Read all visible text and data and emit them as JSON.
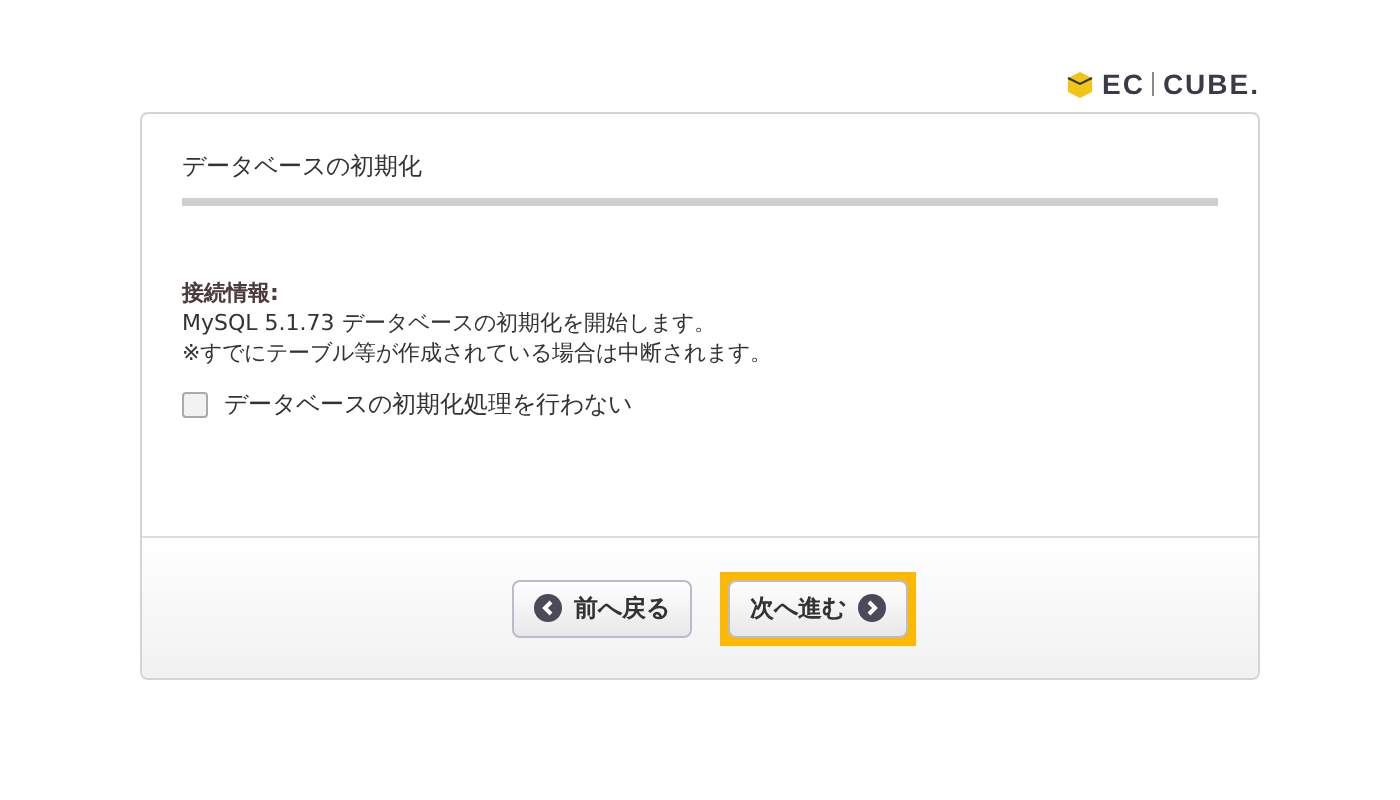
{
  "logo": {
    "left": "EC",
    "right": "CUBE."
  },
  "panel": {
    "title": "データベースの初期化",
    "section_label": "接続情報:",
    "lines": [
      "MySQL 5.1.73 データベースの初期化を開始します。",
      "※すでにテーブル等が作成されている場合は中断されます。"
    ],
    "checkbox": {
      "label": "データベースの初期化処理を行わない",
      "checked": false
    }
  },
  "buttons": [
    {
      "label": "前へ戻る",
      "kind": "back",
      "highlighted": false
    },
    {
      "label": "次へ進む",
      "kind": "next",
      "highlighted": true
    }
  ]
}
